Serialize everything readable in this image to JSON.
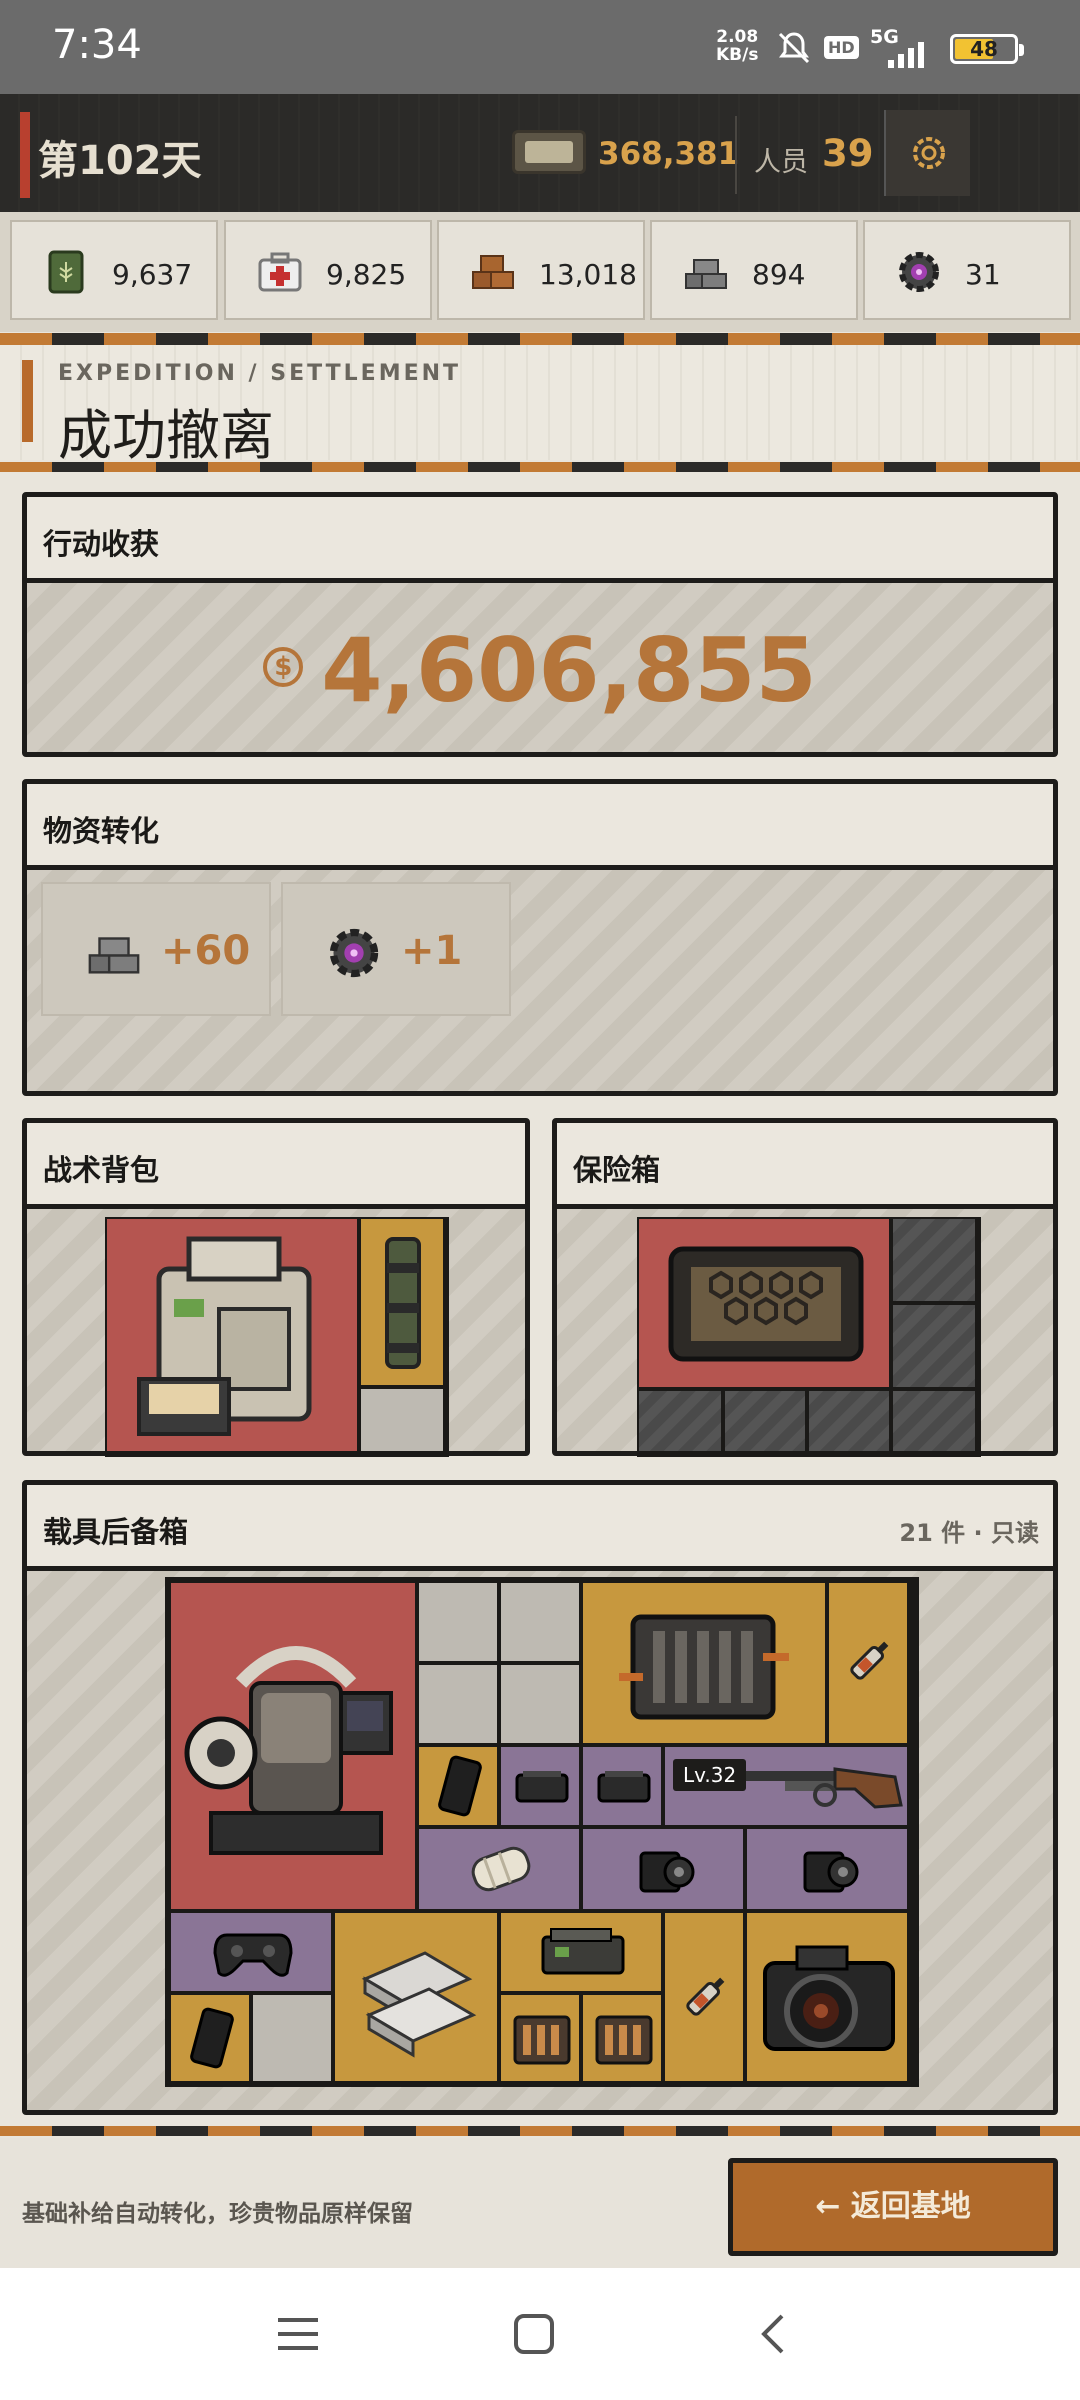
{
  "status": {
    "time": "7:34",
    "net_speed_line1": "2.08",
    "net_speed_line2": "KB/s",
    "hd": "HD",
    "signal": "5G",
    "battery": "48"
  },
  "header": {
    "day": "第102天",
    "money": "368,381",
    "people_label": "人员",
    "people": "39",
    "settings_icon": "gear-icon"
  },
  "resources": [
    {
      "icon": "grain-can-icon",
      "value": "9,637"
    },
    {
      "icon": "medkit-icon",
      "value": "9,825"
    },
    {
      "icon": "wood-blocks-icon",
      "value": "13,018"
    },
    {
      "icon": "metal-ingots-icon",
      "value": "894"
    },
    {
      "icon": "purple-gear-icon",
      "value": "31"
    }
  ],
  "settlement": {
    "en": "EXPEDITION / SETTLEMENT",
    "title": "成功撤离"
  },
  "earnings": {
    "title": "行动收获",
    "coin": "$",
    "amount": "4,606,855"
  },
  "conversion": {
    "title": "物资转化",
    "items": [
      {
        "icon": "metal-ingots-icon",
        "value": "+60"
      },
      {
        "icon": "purple-gear-icon",
        "value": "+1"
      }
    ]
  },
  "backpack": {
    "title": "战术背包"
  },
  "safebox": {
    "title": "保险箱"
  },
  "trunk": {
    "title": "载具后备箱",
    "meta": "21 件 · 只读",
    "level_badge": "Lv.32"
  },
  "footer": {
    "hint": "基础补给自动转化，珍贵物品原样保留",
    "back_button": "← 返回基地"
  },
  "colors": {
    "accent": "#b5753a",
    "header_bg": "#2b2a28",
    "rarity_red": "#b55550",
    "rarity_gold": "#c7983e",
    "rarity_purple": "#8a7596"
  }
}
